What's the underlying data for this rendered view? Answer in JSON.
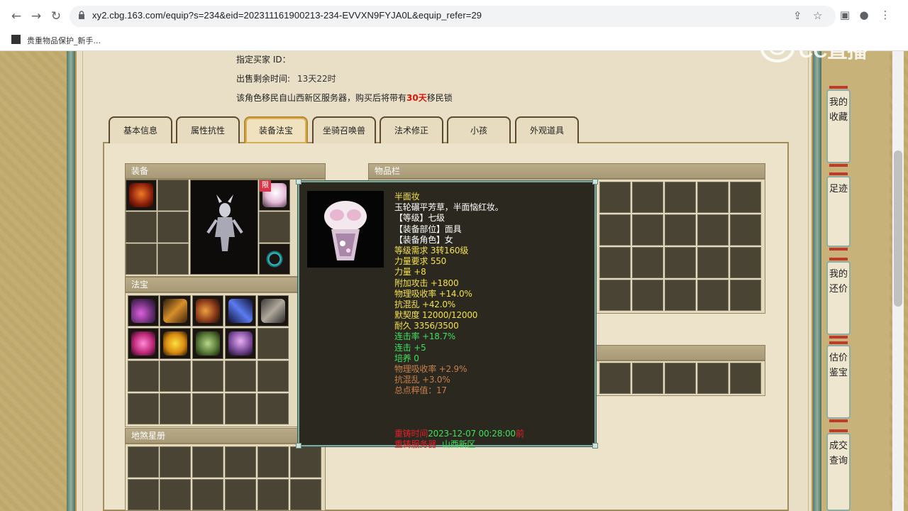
{
  "browser": {
    "url": "xy2.cbg.163.com/equip?s=234&eid=202311161900213-234-EVVXN9FYJA0L&equip_refer=29",
    "bookmark_label": "贵重物品保护_新手..."
  },
  "sale_info": {
    "buyer_id_label": "指定买家 ID：",
    "remaining_label": "出售剩余时间:",
    "remaining_value": "13天22时",
    "migrate_prefix": "该角色移民自山西新区服务器，购买后将带有",
    "migrate_days": "30天",
    "migrate_suffix": "移民锁"
  },
  "tabs": [
    {
      "label": "基本信息"
    },
    {
      "label": "属性抗性"
    },
    {
      "label": "装备法宝"
    },
    {
      "label": "坐骑召唤兽"
    },
    {
      "label": "法术修正"
    },
    {
      "label": "小孩"
    },
    {
      "label": "外观道具"
    }
  ],
  "active_tab": "装备法宝",
  "sections": {
    "equipment": "装备",
    "fabao": "法宝",
    "inventory": "物品栏",
    "disha": "地煞星册"
  },
  "badge_limited": "限",
  "tooltip": {
    "lines": [
      {
        "text": "半面妆",
        "color": "#f3e04a"
      },
      {
        "text": "玉轮碾平芳草，半面恼红妆。",
        "color": "#ffffff"
      },
      {
        "text": "【等级】七级",
        "color": "#ffffff"
      },
      {
        "text": "【装备部位】面具",
        "color": "#ffffff"
      },
      {
        "text": "【装备角色】女",
        "color": "#ffffff"
      },
      {
        "text": "等级需求 3转160级",
        "color": "#f3e04a"
      },
      {
        "text": "力量要求 550",
        "color": "#f3e04a"
      },
      {
        "text": "力量 +8",
        "color": "#f3e04a"
      },
      {
        "text": "附加攻击 +1800",
        "color": "#f3e04a"
      },
      {
        "text": "物理吸收率 +14.0%",
        "color": "#f3e04a"
      },
      {
        "text": "抗混乱 +42.0%",
        "color": "#f3e04a"
      },
      {
        "text": "默契度 12000/12000",
        "color": "#f3e04a"
      },
      {
        "text": "耐久 3356/3500",
        "color": "#f3e04a"
      },
      {
        "text": "连击率 +18.7%",
        "color": "#3fe05a"
      },
      {
        "text": "连击 +5",
        "color": "#3fe05a"
      },
      {
        "text": "培养 0",
        "color": "#3fe05a"
      },
      {
        "text": "物理吸收率 +2.9%",
        "color": "#c8804a"
      },
      {
        "text": "抗混乱 +3.0%",
        "color": "#c8804a"
      },
      {
        "text": "总点粹值：17",
        "color": "#c8804a"
      },
      {
        "text": "",
        "color": "#ffffff"
      },
      {
        "text": "",
        "color": "#ffffff"
      },
      {
        "text": "",
        "color": "#ffffff"
      }
    ],
    "reg_label": "重铸时间",
    "reg_time": "2023-12-07 00:28:00",
    "reg_suffix": "前",
    "server_label": "重铸服务器",
    "server_value": "山西新区"
  },
  "side_nav": [
    {
      "label": "我的收藏"
    },
    {
      "label": "足迹"
    },
    {
      "label": "我的还价"
    },
    {
      "label": "估价鉴宝"
    },
    {
      "label": "成交查询"
    }
  ],
  "watermark_text": "CC直播",
  "colors": {
    "accent_red": "#d8170b",
    "tooltip_yellow": "#f3e04a",
    "tooltip_green": "#3fe05a",
    "tooltip_orange": "#c8804a"
  }
}
